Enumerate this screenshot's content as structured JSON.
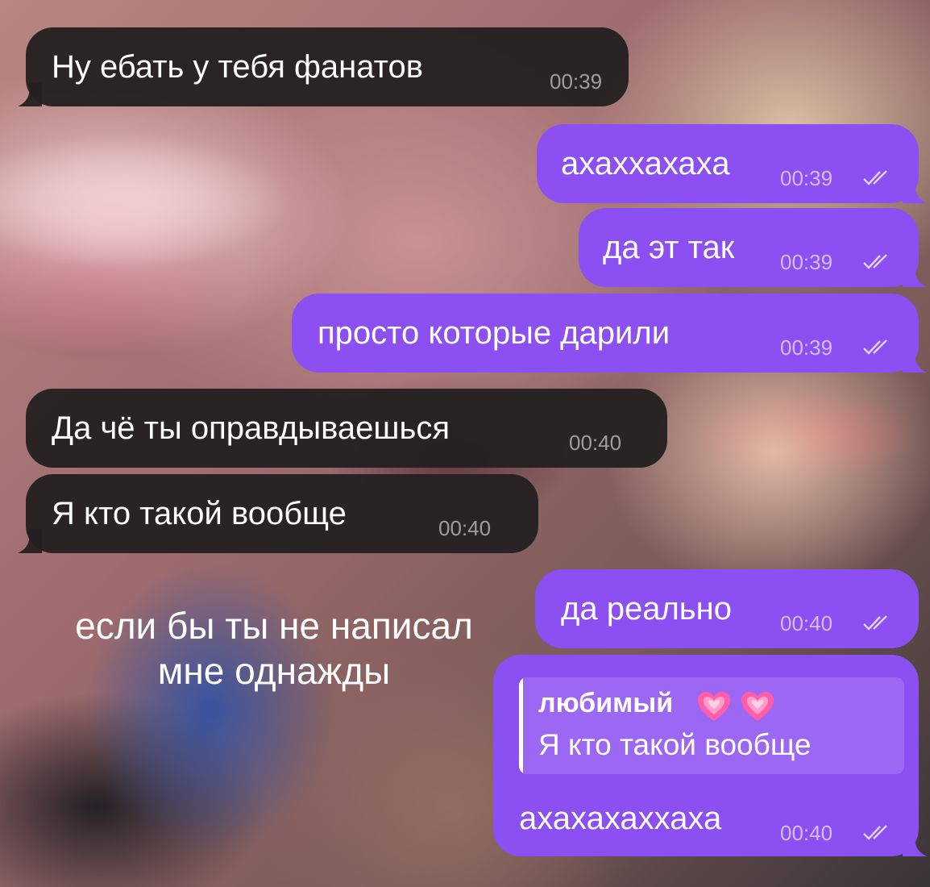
{
  "messages": [
    {
      "direction": "incoming",
      "text": "Ну ебать у тебя фанатов",
      "time": "00:39"
    },
    {
      "direction": "outgoing",
      "text": "ахаххахаха",
      "time": "00:39"
    },
    {
      "direction": "outgoing",
      "text": "да эт так",
      "time": "00:39"
    },
    {
      "direction": "outgoing",
      "text": "просто которые дарили",
      "time": "00:39"
    },
    {
      "direction": "incoming",
      "text": "Да чё ты оправдываешься",
      "time": "00:40"
    },
    {
      "direction": "incoming",
      "text": "Я кто такой вообще",
      "time": "00:40"
    },
    {
      "direction": "outgoing",
      "text": "да реально",
      "time": "00:40"
    },
    {
      "direction": "outgoing",
      "reply": {
        "author": "любимый",
        "text": "Я кто такой вообще"
      },
      "text": "ахахахаххаха",
      "time": "00:40"
    }
  ],
  "caption": {
    "line1": "если бы ты не написал",
    "line2": "мне однажды"
  },
  "icons": {
    "read_receipt": "double-check-icon",
    "reply_emoji": "growing-heart-icon"
  },
  "colors": {
    "incoming_bubble": "#242021",
    "outgoing_bubble": "#8b4ff2",
    "heart": "#ff5fa8"
  }
}
